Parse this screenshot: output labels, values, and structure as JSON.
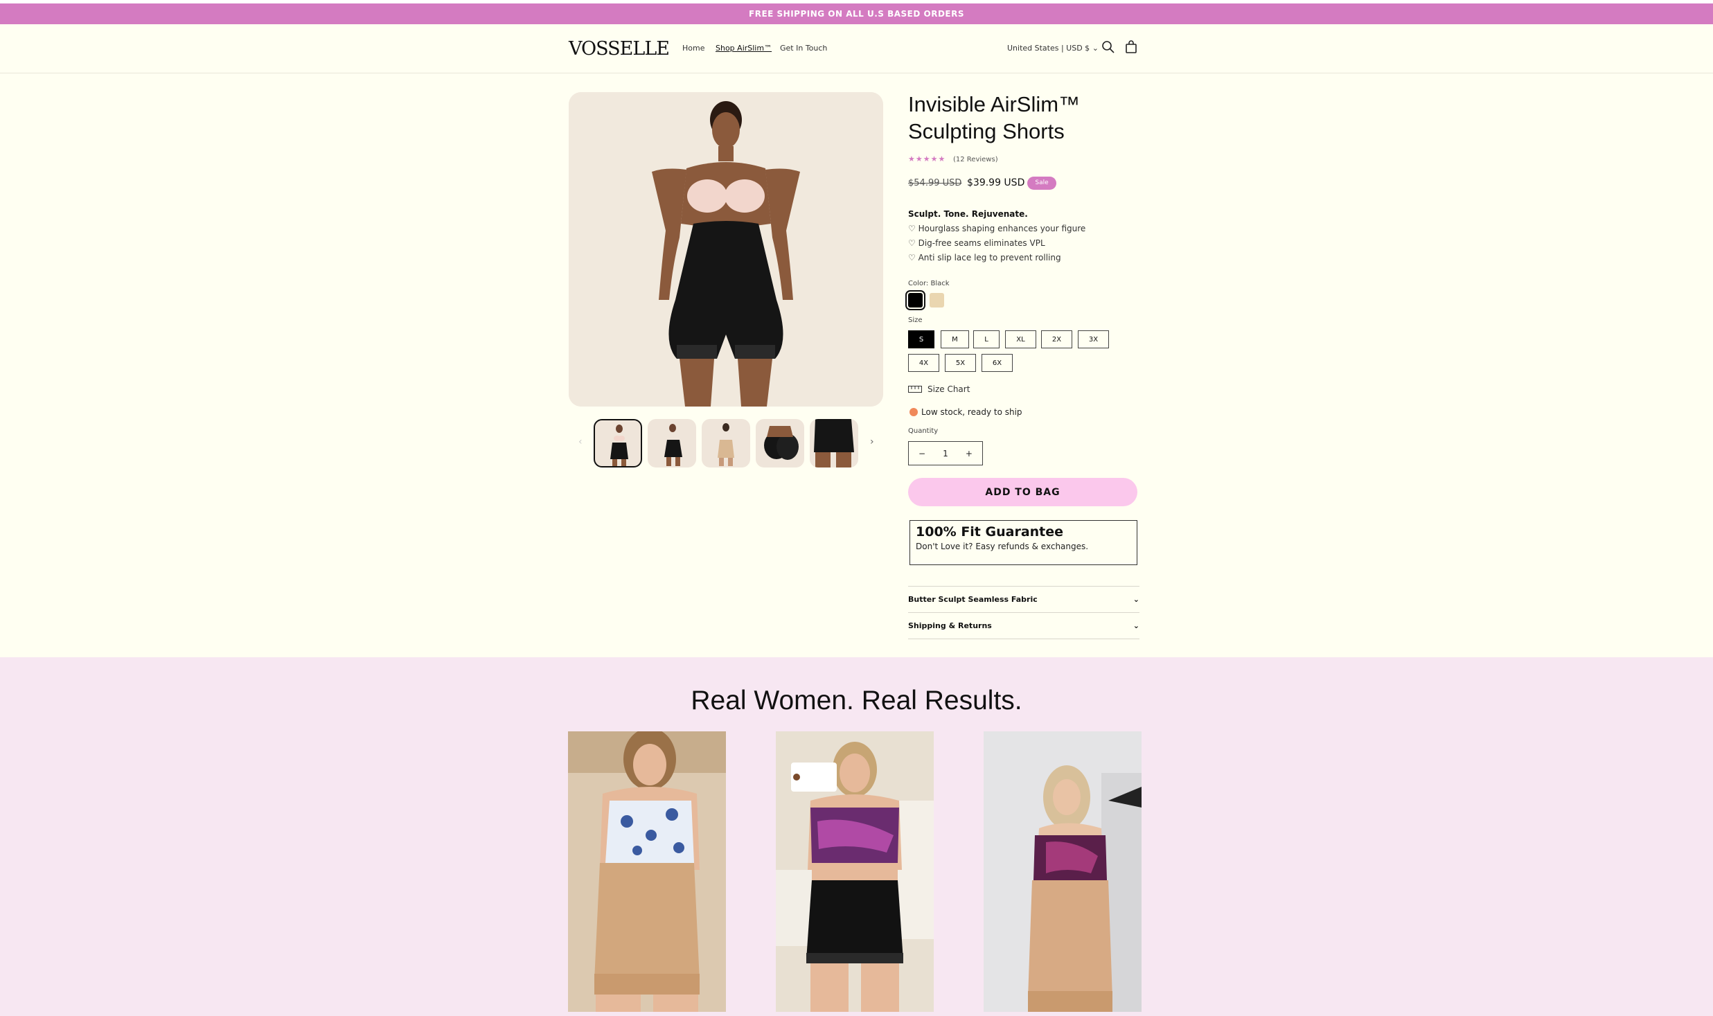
{
  "announcement": "FREE SHIPPING ON ALL U.S BASED ORDERS",
  "header": {
    "logo": "VOSSELLE",
    "nav": [
      "Home",
      "Shop AirSlim™",
      "Get In Touch"
    ],
    "locale": "United States | USD $"
  },
  "product": {
    "title": "Invisible AirSlim™ Sculpting Shorts",
    "rating": 5,
    "reviews": "(12 Reviews)",
    "price_old": "$54.99 USD",
    "price_new": "$39.99 USD",
    "sale_badge": "Sale",
    "tagline": "Sculpt. Tone. Rejuvenate.",
    "bullets": [
      "♡ Hourglass shaping enhances your figure",
      "♡ Dig-free seams eliminates VPL",
      "♡ Anti slip lace leg to prevent rolling"
    ],
    "color_label": "Color: Black",
    "colors": [
      "#000000",
      "#ead6b0"
    ],
    "size_label": "Size",
    "sizes": [
      "S",
      "M",
      "L",
      "XL",
      "2X",
      "3X",
      "4X",
      "5X",
      "6X"
    ],
    "selected_size": "S",
    "size_chart": "Size Chart",
    "stock": "Low stock, ready to ship",
    "quantity_label": "Quantity",
    "quantity": "1",
    "add_to_bag": "ADD TO BAG",
    "guarantee_title": "100% Fit Guarantee",
    "guarantee_sub": "Don't Love it? Easy refunds & exchanges.",
    "accordions": [
      "Butter Sculpt Seamless Fabric",
      "Shipping & Returns"
    ]
  },
  "results": {
    "title": "Real Women. Real Results."
  },
  "colors": {
    "announcement_bg": "#d47bc1",
    "page_bg": "#fffff2",
    "section_bg": "#f7e7f2",
    "add_button": "#fbc8ec"
  }
}
